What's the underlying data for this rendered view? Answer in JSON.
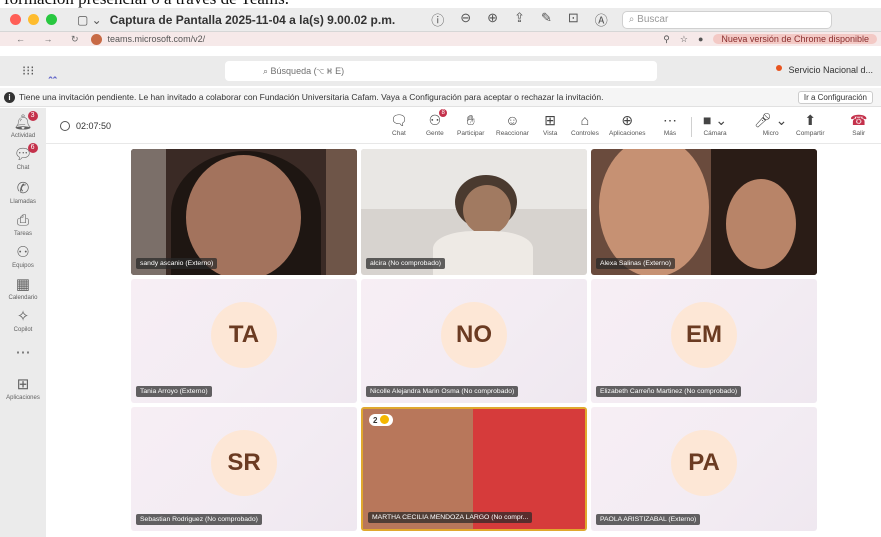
{
  "doc_banner": {
    "text": "formación presencial o a través de Teams."
  },
  "titlebar": {
    "title": "Captura de Pantalla 2025-11-04 a la(s) 9.00.02 p.m.",
    "search_placeholder": "Buscar",
    "tools": [
      "ⓘ",
      "⊖",
      "⊕",
      "⇪",
      "✎",
      "⊡",
      "Ⓐ"
    ]
  },
  "browser": {
    "url": "teams.microsoft.com/v2/",
    "update_label": "Nueva versión de Chrome disponible"
  },
  "teams": {
    "search_placeholder": "Búsqueda (⌥ ⌘ E)",
    "org_name": "Servicio Nacional d..."
  },
  "invite": {
    "message": "Tiene una invitación pendiente. Le han invitado a colaborar con Fundación Universitaria Cafam. Vaya a Configuración para aceptar o rechazar la invitación.",
    "button": "Ir a Configuración"
  },
  "rail": [
    {
      "label": "Actividad",
      "icon": "bell-icon",
      "badge": "3"
    },
    {
      "label": "Chat",
      "icon": "chat-icon",
      "badge": "6"
    },
    {
      "label": "Llamadas",
      "icon": "phone-icon",
      "badge": ""
    },
    {
      "label": "Tareas",
      "icon": "tasks-icon",
      "badge": ""
    },
    {
      "label": "Equipos",
      "icon": "teams-icon",
      "badge": ""
    },
    {
      "label": "Calendario",
      "icon": "calendar-icon",
      "badge": ""
    },
    {
      "label": "Copilot",
      "icon": "copilot-icon",
      "badge": ""
    },
    {
      "label": "",
      "icon": "more-icon",
      "badge": ""
    },
    {
      "label": "Aplicaciones",
      "icon": "add-apps-icon",
      "badge": ""
    }
  ],
  "meeting": {
    "timer": "02:07:50",
    "controls": [
      {
        "label": "Chat",
        "icon": "chat-icon"
      },
      {
        "label": "Gente",
        "icon": "people-icon",
        "badge": "8"
      },
      {
        "label": "Participar",
        "icon": "raise-hand-icon"
      },
      {
        "label": "Reaccionar",
        "icon": "smile-icon"
      },
      {
        "label": "Vista",
        "icon": "grid-view-icon"
      },
      {
        "label": "Controles",
        "icon": "controls-icon"
      },
      {
        "label": "Aplicaciones",
        "icon": "apps-icon"
      },
      {
        "label": "Más",
        "icon": "more-icon"
      },
      {
        "label": "Cámara",
        "icon": "camera-off-icon"
      },
      {
        "label": "Micro",
        "icon": "mic-icon"
      },
      {
        "label": "Compartir",
        "icon": "share-icon"
      },
      {
        "label": "Salir",
        "icon": "leave-icon"
      }
    ]
  },
  "participants": [
    {
      "name": "sandy ascanio (Externo)",
      "type": "video"
    },
    {
      "name": "alcira (No comprobado)",
      "type": "video"
    },
    {
      "name": "Alexa Salinas (Externo)",
      "type": "video"
    },
    {
      "name": "Tania Arroyo (Externo)",
      "type": "avatar",
      "initials": "TA"
    },
    {
      "name": "Nicolle Alejandra Marin Osma (No comprobado)",
      "type": "avatar",
      "initials": "NO"
    },
    {
      "name": "Elizabeth Carreño Martinez (No comprobado)",
      "type": "avatar",
      "initials": "EM"
    },
    {
      "name": "Sebastian Rodriguez (No comprobado)",
      "type": "avatar",
      "initials": "SR"
    },
    {
      "name": "MARTHA CECILIA MENDOZA LARGO (No compr...",
      "type": "video",
      "reaction_count": "2"
    },
    {
      "name": "PAOLA ARISTIZABAL (Externo)",
      "type": "avatar",
      "initials": "PA"
    }
  ],
  "colors": {
    "avatar_bg": "#fde7d6",
    "badge": "#c4314b",
    "leave": "#c4314b",
    "teams_brand": "#5b5fc7"
  }
}
